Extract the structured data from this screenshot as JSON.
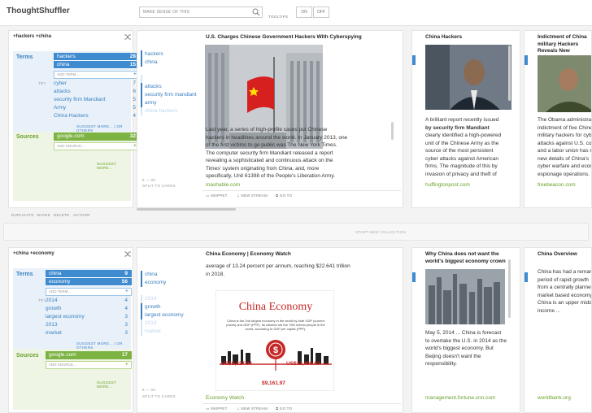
{
  "app": {
    "title": "ThoughtShuffler"
  },
  "search": {
    "placeholder": "MAKE SENSE OF THIS"
  },
  "tooltips": {
    "label": "TOOLTIPS",
    "on": "ON",
    "off": "OFF"
  },
  "toolbar": {
    "duplicate": "DUPLICATE",
    "share": "SHARE",
    "delete": "DELETE",
    "author": "AUTHOR",
    "new_collection": "START NEW COLLECTION"
  },
  "stream1": {
    "title": "+hackers +china",
    "terms_label": "Terms",
    "sources_label": "Sources",
    "try_label": "TRY",
    "terms": [
      {
        "label": "hackers",
        "count": "28"
      },
      {
        "label": "china",
        "count": "15"
      }
    ],
    "add_term": "ADD TERM...",
    "suggestions": [
      {
        "label": "cyber",
        "count": "7"
      },
      {
        "label": "attacks",
        "count": "6"
      },
      {
        "label": "security firm Mandiant",
        "count": "5"
      },
      {
        "label": "Army",
        "count": "5"
      },
      {
        "label": "China Hackers",
        "count": "4"
      }
    ],
    "suggest_more": "SUGGEST MORE... | OR OTHERS",
    "sources": [
      {
        "label": "google.com",
        "count": "32"
      }
    ],
    "add_source": "ADD SOURCE...",
    "suggest_more_src": "SUGGEST MORE...",
    "main": {
      "tags": [
        "hackers",
        "china",
        "attacks",
        "security firm mandiant",
        "army",
        "china hackers"
      ],
      "title": "U.S. Charges Chinese Government Hackers With Cyberspying",
      "p1": "Last year, a series of high-profile cases put Chinese",
      "p2": "hackers in headlines around the world. In January 2013, one",
      "p3": "of the first victims to go public was The New York Times.",
      "p4": "The computer security firm Mandiant released a report",
      "p5": "revealing a sophisticated and continuous attack on the",
      "p6": "Times' system originating from China, and, more",
      "p7": "specifically, Unit 61398 of the People's Liberation Army.",
      "source": "mashable.com",
      "pages": "6 — 00",
      "split": "SPLIT TO CARDS",
      "snippet": "SNIPPET",
      "newstream": "NEW STREAM",
      "goto": "GO TO"
    },
    "card2": {
      "title": "China Hackers",
      "lines": [
        "A brilliant report recently issued",
        "by security firm Mandiant",
        "clearly identified a high-powered",
        "unit of the Chinese Army as the",
        "source of the most persistent",
        "cyber attacks against American",
        "firms. The magnitude of this by",
        "invasion of privacy and theft of"
      ],
      "source": "huffingtonpost.com"
    },
    "card3": {
      "title_lines": [
        "Indictment of China",
        "military Hackers",
        "Reveals New"
      ],
      "lines": [
        "The Obama administration",
        "indictment of five Chinese",
        "military hackers for cyber",
        "attacks against U.S. companies",
        "and a labor union has revealed",
        "new details of China's",
        "cyber warfare and economic",
        "espionage operations."
      ],
      "source": "freebeacon.com"
    }
  },
  "stream2": {
    "title": "+china +economy",
    "terms_label": "Terms",
    "sources_label": "Sources",
    "try_label": "TRY",
    "terms": [
      {
        "label": "china",
        "count": "9"
      },
      {
        "label": "economy",
        "count": "56"
      }
    ],
    "add_term": "ADD TERM...",
    "suggestions": [
      {
        "label": "2014",
        "count": "4"
      },
      {
        "label": "growth",
        "count": "4"
      },
      {
        "label": "largest economy",
        "count": "3"
      },
      {
        "label": "2013",
        "count": "3"
      },
      {
        "label": "market",
        "count": "3"
      }
    ],
    "suggest_more": "SUGGEST MORE... | OR OTHERS",
    "sources": [
      {
        "label": "google.com",
        "count": "17"
      }
    ],
    "add_source": "ADD SOURCE...",
    "suggest_more_src": "SUGGEST MORE...",
    "main": {
      "tags": [
        "china",
        "economy",
        "2014",
        "growth",
        "largest economy",
        "2013",
        "market"
      ],
      "title": "China Economy | Economy Watch",
      "p1": "average of 13.24 percent per annum, reaching $22.641 trillion",
      "p2": "in 2018.",
      "infographic_title": "China Economy",
      "infographic_text": "China is the 2nd largest economy in the world by both GDP (current prices) and GDP (PPP). Its citizens are the 79th richest people in the world, according to GDP per capita (PPP).",
      "val1": "US$8,227.04",
      "val2": "US$12,405.67",
      "val3": "$9,161.97",
      "source": "Economy Watch",
      "pages": "6 — 00",
      "split": "SPLIT TO CARDS",
      "snippet": "SNIPPET",
      "newstream": "NEW STREAM",
      "goto": "GO TO"
    },
    "card2": {
      "title_lines": [
        "Why China does not want the",
        "world's biggest economy crown"
      ],
      "lines": [
        "May 5, 2014 ... China is forecast",
        "to overtake the U.S. in 2014 as the",
        "world's biggest economy. But",
        "Beijing doesn't want the",
        "responsibility."
      ],
      "source": "management.fortune.cnn.com"
    },
    "card3": {
      "title": "China Overview",
      "lines": [
        "China has had a remarkable",
        "period of rapid growth",
        "from a centrally planned",
        "market based economy",
        "China is an upper middle",
        "income ..."
      ],
      "source": "worldbank.org"
    }
  },
  "colors": {
    "accent": "#3f8bd0",
    "source": "#7cb342"
  }
}
